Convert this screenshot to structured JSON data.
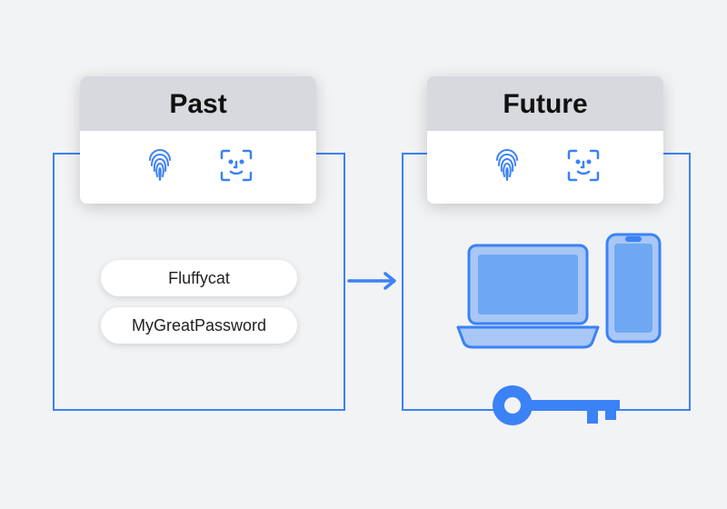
{
  "diagram": {
    "left_title": "Past",
    "right_title": "Future",
    "passwords": [
      "Fluffycat",
      "MyGreatPassword"
    ],
    "icons": {
      "fingerprint": "fingerprint-icon",
      "faceid": "faceid-icon",
      "laptop": "laptop-icon",
      "phone": "phone-icon",
      "key": "key-icon",
      "arrow": "arrow-right-icon"
    },
    "colors": {
      "accent": "#3b82f6",
      "accent_light": "#a9c7f5",
      "accent_mid": "#6ea8f2"
    }
  }
}
